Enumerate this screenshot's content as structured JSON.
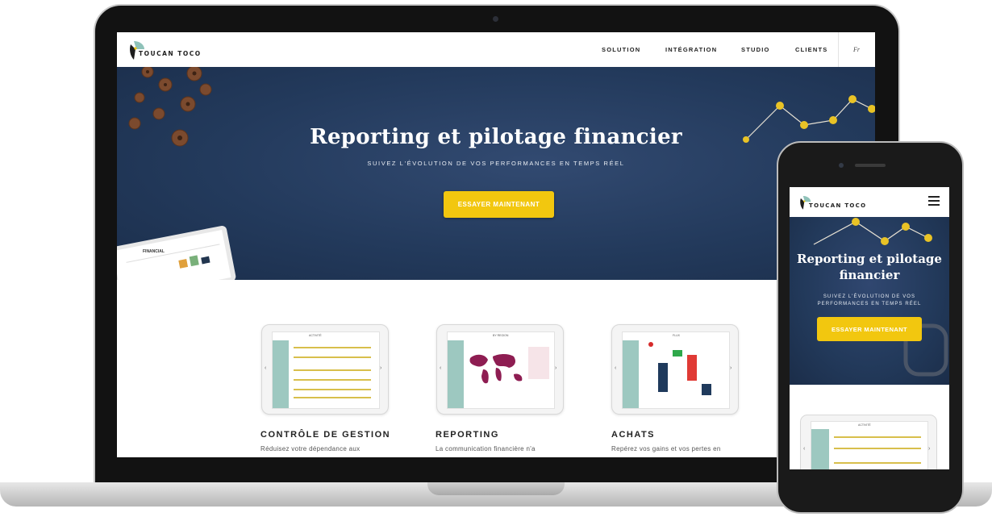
{
  "site": {
    "brand": "TOUCAN TOCO",
    "nav": [
      "SOLUTION",
      "INTÉGRATION",
      "STUDIO",
      "CLIENTS"
    ],
    "lang": "Fr"
  },
  "hero": {
    "title": "Reporting et pilotage financier",
    "subtitle": "SUIVEZ L'ÉVOLUTION DE VOS PERFORMANCES EN TEMPS RÉEL",
    "cta": "ESSAYER MAINTENANT",
    "tablet_label": "FINANCIAL"
  },
  "features": [
    {
      "title": "CONTRÔLE DE GESTION",
      "text": "Réduisez votre dépendance aux",
      "screen_label": "ACTIVITÉ"
    },
    {
      "title": "REPORTING",
      "text": "La communication financière n'a",
      "screen_label": "BY REGION"
    },
    {
      "title": "ACHATS",
      "text": "Repérez vos gains et vos pertes en",
      "screen_label": "FLUX"
    }
  ],
  "mobile": {
    "brand": "TOUCAN TOCO",
    "title": "Reporting et pilotage financier",
    "subtitle": "SUIVEZ L'ÉVOLUTION DE VOS PERFORMANCES EN TEMPS RÉEL",
    "cta": "ESSAYER MAINTENANT",
    "screen_label": "ACTIVITÉ"
  },
  "colors": {
    "navy": "#233a5c",
    "yellow": "#f2c70f",
    "teal": "#9dc8c0",
    "maroon": "#8e1d52"
  }
}
